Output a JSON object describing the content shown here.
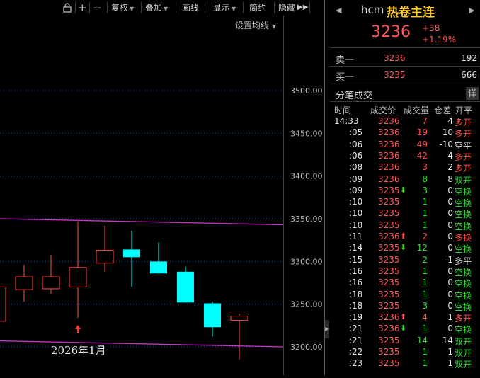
{
  "toolbar": {
    "buttons": [
      {
        "label": "复权",
        "dropdown": true
      },
      {
        "label": "叠加",
        "dropdown": true
      },
      {
        "label": "画线",
        "dropdown": false
      },
      {
        "label": "显示",
        "dropdown": true
      },
      {
        "label": "简约",
        "dropdown": false
      },
      {
        "label": "隐藏",
        "dropdown": false
      }
    ],
    "icons": [
      "lock-icon",
      "plus-icon",
      "minus-icon",
      "expand-icon"
    ]
  },
  "chart": {
    "ma_setting_label": "设置均线",
    "date_label": "2026年1月",
    "y_ticks": [
      "3500.00",
      "3450.00",
      "3400.00",
      "3350.00",
      "3300.00",
      "3250.00",
      "3200.00"
    ]
  },
  "chart_data": {
    "type": "candlestick",
    "y_ticks": [
      3500,
      3450,
      3400,
      3350,
      3300,
      3250,
      3200
    ],
    "ylim": [
      3185,
      3540
    ],
    "candles": [
      {
        "open": 3230,
        "high": 3270,
        "low": 3195,
        "close": 3270,
        "direction": "up"
      },
      {
        "open": 3267,
        "high": 3296,
        "low": 3253,
        "close": 3282,
        "direction": "up"
      },
      {
        "open": 3282,
        "high": 3308,
        "low": 3262,
        "close": 3268,
        "direction": "up"
      },
      {
        "open": 3270,
        "high": 3347,
        "low": 3234,
        "close": 3293,
        "direction": "up"
      },
      {
        "open": 3298,
        "high": 3342,
        "low": 3288,
        "close": 3313,
        "direction": "up"
      },
      {
        "open": 3314,
        "high": 3336,
        "low": 3270,
        "close": 3305,
        "direction": "down"
      },
      {
        "open": 3300,
        "high": 3322,
        "low": 3288,
        "close": 3286,
        "direction": "down"
      },
      {
        "open": 3288,
        "high": 3294,
        "low": 3252,
        "close": 3252,
        "direction": "down"
      },
      {
        "open": 3251,
        "high": 3253,
        "low": 3212,
        "close": 3223,
        "direction": "down"
      },
      {
        "open": 3231,
        "high": 3239,
        "low": 3185,
        "close": 3236,
        "direction": "up"
      }
    ],
    "bands": {
      "upper": [
        3350,
        3343
      ],
      "lower": [
        3207,
        3200
      ]
    }
  },
  "quote": {
    "code": "hcm",
    "name": "热卷主连",
    "price": "3236",
    "change": "+38",
    "change_pct": "+1.19%"
  },
  "orderbook": {
    "sell": {
      "label": "卖一",
      "price": "3236",
      "volume": "192"
    },
    "buy": {
      "label": "买一",
      "price": "3235",
      "volume": "666"
    }
  },
  "ticks": {
    "title": "分笔成交",
    "detail_label": "详",
    "headers": [
      "时间",
      "成交价",
      "成交量",
      "仓差",
      "开平"
    ],
    "rows": [
      {
        "time": "14:33",
        "price": "3236",
        "arrow": "",
        "vol": "7",
        "oi": "4",
        "type": "多开"
      },
      {
        "time": ":05",
        "price": "3236",
        "arrow": "",
        "vol": "19",
        "oi": "10",
        "type": "多开"
      },
      {
        "time": ":06",
        "price": "3236",
        "arrow": "",
        "vol": "49",
        "oi": "-10",
        "type": "空平"
      },
      {
        "time": ":06",
        "price": "3236",
        "arrow": "",
        "vol": "42",
        "oi": "4",
        "type": "多开"
      },
      {
        "time": ":08",
        "price": "3236",
        "arrow": "",
        "vol": "3",
        "oi": "2",
        "type": "多开"
      },
      {
        "time": ":09",
        "price": "3236",
        "arrow": "",
        "vol": "8",
        "oi": "8",
        "type": "双开"
      },
      {
        "time": ":09",
        "price": "3235",
        "arrow": "down",
        "vol": "3",
        "oi": "0",
        "type": "空换"
      },
      {
        "time": ":10",
        "price": "3235",
        "arrow": "",
        "vol": "1",
        "oi": "0",
        "type": "空换"
      },
      {
        "time": ":10",
        "price": "3235",
        "arrow": "",
        "vol": "1",
        "oi": "0",
        "type": "空换"
      },
      {
        "time": ":10",
        "price": "3235",
        "arrow": "",
        "vol": "1",
        "oi": "0",
        "type": "空换"
      },
      {
        "time": ":11",
        "price": "3236",
        "arrow": "up",
        "vol": "2",
        "oi": "0",
        "type": "多换"
      },
      {
        "time": ":14",
        "price": "3235",
        "arrow": "down",
        "vol": "12",
        "oi": "0",
        "type": "空换"
      },
      {
        "time": ":15",
        "price": "3235",
        "arrow": "",
        "vol": "2",
        "oi": "-1",
        "type": "多平"
      },
      {
        "time": ":16",
        "price": "3235",
        "arrow": "",
        "vol": "1",
        "oi": "0",
        "type": "空换"
      },
      {
        "time": ":16",
        "price": "3235",
        "arrow": "",
        "vol": "1",
        "oi": "0",
        "type": "空换"
      },
      {
        "time": ":18",
        "price": "3235",
        "arrow": "",
        "vol": "1",
        "oi": "0",
        "type": "空换"
      },
      {
        "time": ":18",
        "price": "3235",
        "arrow": "",
        "vol": "3",
        "oi": "0",
        "type": "空换"
      },
      {
        "time": ":19",
        "price": "3236",
        "arrow": "up",
        "vol": "4",
        "oi": "1",
        "type": "多开"
      },
      {
        "time": ":21",
        "price": "3236",
        "arrow": "down",
        "vol": "1",
        "oi": "0",
        "type": "空换"
      },
      {
        "time": ":21",
        "price": "3235",
        "arrow": "",
        "vol": "14",
        "oi": "14",
        "type": "双开"
      },
      {
        "time": ":22",
        "price": "3235",
        "arrow": "",
        "vol": "1",
        "oi": "1",
        "type": "双开"
      },
      {
        "time": ":23",
        "price": "3235",
        "arrow": "",
        "vol": "1",
        "oi": "1",
        "type": "双开"
      }
    ]
  },
  "colors": {
    "up": "#ff4d4d",
    "down": "#00ffff",
    "price_up": "#ff5a5a",
    "green": "#33dd33",
    "band": "#cc33cc",
    "name": "#ffcc33",
    "dotted": "#1e4a7a"
  }
}
